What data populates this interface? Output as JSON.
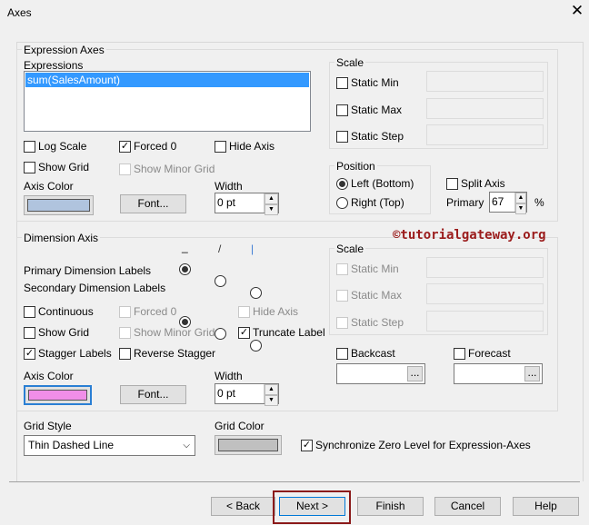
{
  "window": {
    "title": "Axes",
    "close_icon": "close-icon"
  },
  "expression_axes": {
    "group_label": "Expression Axes",
    "expressions_label": "Expressions",
    "expressions": [
      "sum(SalesAmount)"
    ],
    "log_scale": {
      "label": "Log Scale",
      "checked": false
    },
    "forced0": {
      "label": "Forced 0",
      "checked": true
    },
    "hide_axis": {
      "label": "Hide Axis",
      "checked": false
    },
    "show_grid": {
      "label": "Show Grid",
      "checked": false
    },
    "show_minor_grid": {
      "label": "Show Minor Grid",
      "checked": false,
      "disabled": true
    },
    "axis_color_label": "Axis Color",
    "axis_color": "#b0c4de",
    "font_button": "Font...",
    "width_label": "Width",
    "width_value": "0 pt",
    "scale": {
      "label": "Scale",
      "static_min": "Static Min",
      "static_max": "Static Max",
      "static_step": "Static Step"
    },
    "position": {
      "label": "Position",
      "left_bottom": "Left (Bottom)",
      "right_top": "Right (Top)",
      "selected": "left_bottom"
    },
    "split_axis": {
      "label": "Split Axis",
      "checked": false
    },
    "primary_label": "Primary",
    "primary_value": "67",
    "percent": "%"
  },
  "dimension_axis": {
    "group_label": "Dimension Axis",
    "orientation_headers": [
      "_",
      "/",
      "|"
    ],
    "primary_labels": "Primary Dimension Labels",
    "secondary_labels": "Secondary Dimension Labels",
    "continuous": {
      "label": "Continuous",
      "checked": false
    },
    "forced0": {
      "label": "Forced 0",
      "disabled": true
    },
    "hide_axis": {
      "label": "Hide Axis",
      "disabled": true
    },
    "show_grid": {
      "label": "Show Grid",
      "checked": false
    },
    "show_minor_grid": {
      "label": "Show Minor Grid",
      "disabled": true
    },
    "truncate_label": {
      "label": "Truncate Label",
      "checked": true
    },
    "stagger_labels": {
      "label": "Stagger Labels",
      "checked": true
    },
    "reverse_stagger": {
      "label": "Reverse Stagger",
      "checked": false
    },
    "axis_color_label": "Axis Color",
    "axis_color": "#f08ee8",
    "font_button": "Font...",
    "width_label": "Width",
    "width_value": "0 pt",
    "scale": {
      "label": "Scale",
      "static_min": "Static Min",
      "static_max": "Static Max",
      "static_step": "Static Step"
    },
    "backcast": "Backcast",
    "forecast": "Forecast",
    "browse": "..."
  },
  "watermark": "©tutorialgateway.org",
  "grid_style": {
    "label": "Grid Style",
    "value": "Thin Dashed Line"
  },
  "grid_color": {
    "label": "Grid Color",
    "color": "#c0c0c0"
  },
  "synchronize": {
    "label": "Synchronize Zero Level for Expression-Axes",
    "checked": true
  },
  "buttons": {
    "back": "< Back",
    "next": "Next >",
    "finish": "Finish",
    "cancel": "Cancel",
    "help": "Help"
  },
  "highlight_color": "#8b1a1a"
}
